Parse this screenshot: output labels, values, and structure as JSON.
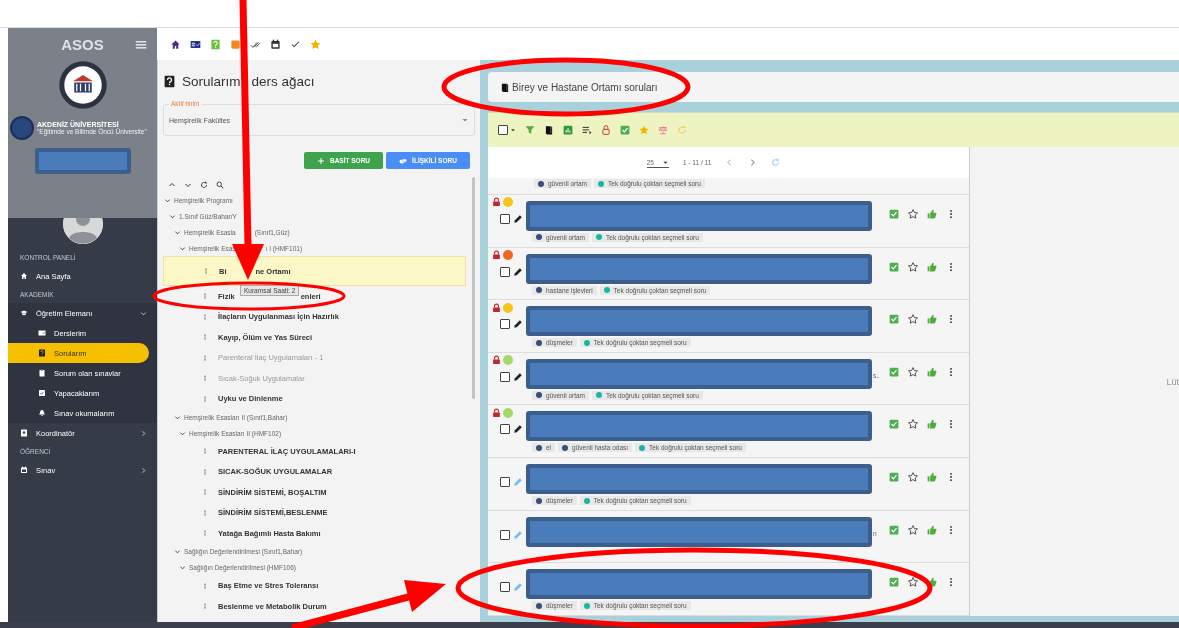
{
  "sidebar": {
    "brand": "ASOS",
    "university": "AKDENİZ ÜNİVERSİTESİ",
    "motto": "\"Eğitimde ve Bilimde Öncü Üniversite\"",
    "sections": [
      {
        "heading": "KONTROL PANELİ",
        "items": [
          {
            "label": "Ana Sayfa",
            "selected": false
          }
        ]
      },
      {
        "heading": "AKADEMİK",
        "items": [
          {
            "label": "Öğretim Elemanı",
            "selected": false,
            "expanded": true,
            "children": [
              {
                "label": "Derslerim",
                "selected": false
              },
              {
                "label": "Sorularım",
                "selected": true
              },
              {
                "label": "Sorum olan sınavlar",
                "selected": false
              },
              {
                "label": "Yapacaklarım",
                "selected": false
              },
              {
                "label": "Sınav okumalarım",
                "selected": false
              }
            ]
          },
          {
            "label": "Koordinatör",
            "selected": false,
            "expanded": false
          }
        ]
      },
      {
        "heading": "ÖĞRENCİ",
        "items": [
          {
            "label": "Sınav",
            "selected": false,
            "expanded": false
          }
        ]
      }
    ]
  },
  "tree_panel": {
    "title": [
      "Sorularım",
      "ders ağacı"
    ],
    "unit_select": {
      "label": "Aktif birim",
      "value": "Hemşirelik Fakültes"
    },
    "buttons": [
      {
        "label": "BASİT SORU",
        "kind": "basic"
      },
      {
        "label": "İLİŞKİLİ SORU",
        "kind": "related"
      }
    ],
    "tree": [
      {
        "kind": "folder",
        "parts": [
          "Hemşirelik Programı"
        ],
        "expanded": true,
        "children": [
          {
            "kind": "folder",
            "parts": [
              "1.Sınıf Güz/Bahar/Y"
            ],
            "expanded": true,
            "children": [
              {
                "kind": "folder",
                "parts": [
                  "Hemşirelik Esasla",
                  "(Sınıf1,Güz)"
                ],
                "expanded": true,
                "children": [
                  {
                    "kind": "folder",
                    "parts": [
                      "Hemşirelik Esas",
                      "ı I (HMF101)"
                    ],
                    "expanded": true,
                    "children": [
                      {
                        "kind": "topic",
                        "parts": [
                          "Bi",
                          "ne Ortamı"
                        ],
                        "selected": true,
                        "disabled": false
                      },
                      {
                        "kind": "topic",
                        "parts": [
                          "Fizik",
                          "enleri"
                        ],
                        "selected": false,
                        "disabled": false,
                        "tooltip": "Kuramsal Saati: 2"
                      },
                      {
                        "kind": "topic",
                        "parts": [
                          "İlaçların Uygulanması İçin Hazırlık"
                        ],
                        "selected": false,
                        "disabled": false
                      },
                      {
                        "kind": "topic",
                        "parts": [
                          "Kayıp, Ölüm ve Yas Süreci"
                        ],
                        "selected": false,
                        "disabled": false
                      },
                      {
                        "kind": "topic",
                        "parts": [
                          "Parenteral İlaç Uygulamaları - 1"
                        ],
                        "selected": false,
                        "disabled": true
                      },
                      {
                        "kind": "topic",
                        "parts": [
                          "Sıcak-Soğuk Uygulamalar"
                        ],
                        "selected": false,
                        "disabled": true
                      },
                      {
                        "kind": "topic",
                        "parts": [
                          "Uyku ve Dinlenme"
                        ],
                        "selected": false,
                        "disabled": false
                      }
                    ]
                  }
                ]
              },
              {
                "kind": "folder",
                "parts": [
                  "Hemşirelik Esasları II (Sınıf1,Bahar)"
                ],
                "expanded": true,
                "children": [
                  {
                    "kind": "folder",
                    "parts": [
                      "Hemşirelik Esasları II (HMF102)"
                    ],
                    "expanded": true,
                    "children": [
                      {
                        "kind": "topic",
                        "parts": [
                          "PARENTERAL İLAÇ UYGULAMALARI-I"
                        ],
                        "selected": false,
                        "disabled": false
                      },
                      {
                        "kind": "topic",
                        "parts": [
                          "SICAK-SOĞUK UYGULAMALAR"
                        ],
                        "selected": false,
                        "disabled": false
                      },
                      {
                        "kind": "topic",
                        "parts": [
                          "SİNDİRİM SİSTEMİ, BOŞALTIM"
                        ],
                        "selected": false,
                        "disabled": false
                      },
                      {
                        "kind": "topic",
                        "parts": [
                          "SİNDİRİM SİSTEMİ,BESLENME"
                        ],
                        "selected": false,
                        "disabled": false
                      },
                      {
                        "kind": "topic",
                        "parts": [
                          "Yatağa Bağımlı Hasta Bakımı"
                        ],
                        "selected": false,
                        "disabled": false
                      }
                    ]
                  }
                ]
              },
              {
                "kind": "folder",
                "parts": [
                  "Sağlığın Değerlendirilmesi (Sınıf1,Bahar)"
                ],
                "expanded": true,
                "children": [
                  {
                    "kind": "folder",
                    "parts": [
                      "Sağlığın Değerlendirilmesi (HMF106)"
                    ],
                    "expanded": true,
                    "children": [
                      {
                        "kind": "topic",
                        "parts": [
                          "Baş Etme ve Stres Toleransı"
                        ],
                        "selected": false,
                        "disabled": false
                      },
                      {
                        "kind": "topic",
                        "parts": [
                          "Beslenme ve Metabolik Durum"
                        ],
                        "selected": false,
                        "disabled": false
                      }
                    ]
                  }
                ]
              }
            ]
          }
        ]
      }
    ]
  },
  "questions_panel": {
    "title": "Birey ve Hastane Ortamı soruları",
    "select_all": {
      "checked": false
    },
    "pager": {
      "page_size": "25",
      "range": "1 - 11 / 11"
    },
    "empty_hint": "Lüt",
    "rows": [
      {
        "kind": "clipped",
        "tags": [
          {
            "label": "güvenli ortam",
            "color": "#34507a"
          },
          {
            "label": "Tek doğrulu çoktan seçmeli soru",
            "color": "#1ab5a5"
          }
        ]
      },
      {
        "kind": "full",
        "checked": false,
        "locked": true,
        "color": "#f5c518",
        "editable": true,
        "tags": [
          {
            "label": "güvenli ortam",
            "color": "#34507a"
          },
          {
            "label": "Tek doğrulu çoktan seçmeli soru",
            "color": "#1ab5a5"
          }
        ]
      },
      {
        "kind": "full",
        "checked": false,
        "locked": true,
        "color": "#f26522",
        "editable": true,
        "tags": [
          {
            "label": "hastane işlevleri",
            "color": "#34507a"
          },
          {
            "label": "Tek doğrulu çoktan seçmeli soru",
            "color": "#1ab5a5"
          }
        ]
      },
      {
        "kind": "full",
        "checked": false,
        "locked": true,
        "color": "#f5c518",
        "editable": true,
        "tags": [
          {
            "label": "düşmeler",
            "color": "#34507a"
          },
          {
            "label": "Tek doğrulu çoktan seçmeli soru",
            "color": "#1ab5a5"
          }
        ]
      },
      {
        "kind": "full",
        "checked": false,
        "locked": true,
        "color": "#a6d96a",
        "editable": true,
        "overflow": "s..",
        "tags": [
          {
            "label": "güvenli ortam",
            "color": "#34507a"
          },
          {
            "label": "Tek doğrulu çoktan seçmeli soru",
            "color": "#1ab5a5"
          }
        ]
      },
      {
        "kind": "full",
        "checked": false,
        "locked": true,
        "color": "#a6d96a",
        "editable": true,
        "tags": [
          {
            "label": "el",
            "color": "#34507a"
          },
          {
            "label": "güvenli hasta odası",
            "color": "#34507a"
          },
          {
            "label": "Tek doğrulu çoktan seçmeli soru",
            "color": "#1ab5a5"
          }
        ]
      },
      {
        "kind": "full",
        "checked": false,
        "locked": false,
        "editable": false,
        "tags": [
          {
            "label": "düşmeler",
            "color": "#34507a"
          },
          {
            "label": "Tek doğrulu çoktan seçmeli soru",
            "color": "#1ab5a5"
          }
        ]
      },
      {
        "kind": "full",
        "checked": false,
        "locked": false,
        "editable": false,
        "overflow": "n"
      },
      {
        "kind": "full",
        "checked": false,
        "locked": false,
        "editable": false,
        "tags": [
          {
            "label": "düşmeler",
            "color": "#34507a"
          },
          {
            "label": "Tek doğrulu çoktan seçmeli soru",
            "color": "#1ab5a5"
          }
        ]
      }
    ]
  }
}
